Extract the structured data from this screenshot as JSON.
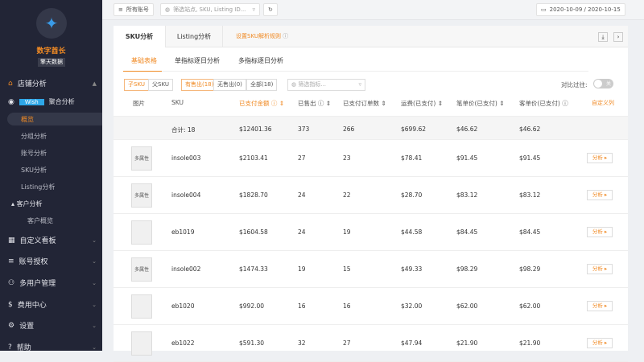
{
  "sidebar": {
    "brand": "数字酋长",
    "brand_sub": "擎天数据",
    "shop": "店铺分析",
    "wish": "Wish",
    "agg": "聚合分析",
    "subs": [
      "概览",
      "分组分析",
      "账号分析",
      "SKU分析",
      "Listing分析"
    ],
    "customer": "客户分析",
    "customer_sub": "客户概览",
    "menus": [
      "自定义看板",
      "账号授权",
      "多用户管理",
      "费用中心",
      "设置",
      "帮助"
    ]
  },
  "topbar": {
    "accounts": "所有账号",
    "filter_placeholder": "筛选站点, SKU, Listing ID...",
    "date_range": "2020-10-09 / 2020-10-15"
  },
  "tabs": {
    "sku": "SKU分析",
    "listing": "Listing分析",
    "rule": "设置SKU解析规则"
  },
  "subtabs": [
    "基础表格",
    "单指标逐日分析",
    "多指标逐日分析"
  ],
  "filters": {
    "child": "子SKU",
    "parent": "父SKU",
    "sold": "有售出(18)",
    "unsold": "无售出(0)",
    "all": "全部(18)",
    "metric_placeholder": "筛选指标...",
    "compare": "对比过往:",
    "toggle": "关"
  },
  "columns": [
    "图片",
    "SKU",
    "已支付金额",
    "已售出",
    "已支付订单数",
    "运费(已支付)",
    "笔单价(已支付)",
    "客单价(已支付)",
    "自定义列"
  ],
  "summary": {
    "label": "合计: 18",
    "amount": "$12401.36",
    "sold": "373",
    "orders": "266",
    "shipping": "$699.62",
    "per_order": "$46.62",
    "per_customer": "$46.62"
  },
  "rows": [
    {
      "thumb": "多属性",
      "sku": "insole003",
      "amount": "$2103.41",
      "sold": "27",
      "orders": "23",
      "shipping": "$78.41",
      "per_order": "$91.45",
      "per_customer": "$91.45",
      "action": "分析"
    },
    {
      "thumb": "多属性",
      "sku": "insole004",
      "amount": "$1828.70",
      "sold": "24",
      "orders": "22",
      "shipping": "$28.70",
      "per_order": "$83.12",
      "per_customer": "$83.12",
      "action": "分析"
    },
    {
      "thumb": "",
      "sku": "eb1019",
      "amount": "$1604.58",
      "sold": "24",
      "orders": "19",
      "shipping": "$44.58",
      "per_order": "$84.45",
      "per_customer": "$84.45",
      "action": "分析"
    },
    {
      "thumb": "多属性",
      "sku": "insole002",
      "amount": "$1474.33",
      "sold": "19",
      "orders": "15",
      "shipping": "$49.33",
      "per_order": "$98.29",
      "per_customer": "$98.29",
      "action": "分析"
    },
    {
      "thumb": "",
      "sku": "eb1020",
      "amount": "$992.00",
      "sold": "16",
      "orders": "16",
      "shipping": "$32.00",
      "per_order": "$62.00",
      "per_customer": "$62.00",
      "action": "分析"
    },
    {
      "thumb": "",
      "sku": "eb1022",
      "amount": "$591.30",
      "sold": "32",
      "orders": "27",
      "shipping": "$47.94",
      "per_order": "$21.90",
      "per_customer": "$21.90",
      "action": "分析"
    }
  ]
}
